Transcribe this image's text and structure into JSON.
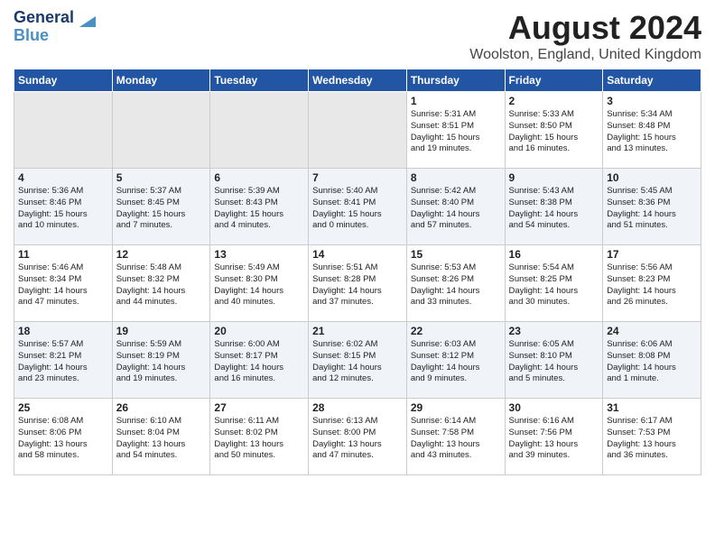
{
  "header": {
    "logo_line1": "General",
    "logo_line2": "Blue",
    "month_year": "August 2024",
    "location": "Woolston, England, United Kingdom"
  },
  "days_of_week": [
    "Sunday",
    "Monday",
    "Tuesday",
    "Wednesday",
    "Thursday",
    "Friday",
    "Saturday"
  ],
  "weeks": [
    [
      {
        "day": "",
        "info": ""
      },
      {
        "day": "",
        "info": ""
      },
      {
        "day": "",
        "info": ""
      },
      {
        "day": "",
        "info": ""
      },
      {
        "day": "1",
        "info": "Sunrise: 5:31 AM\nSunset: 8:51 PM\nDaylight: 15 hours\nand 19 minutes."
      },
      {
        "day": "2",
        "info": "Sunrise: 5:33 AM\nSunset: 8:50 PM\nDaylight: 15 hours\nand 16 minutes."
      },
      {
        "day": "3",
        "info": "Sunrise: 5:34 AM\nSunset: 8:48 PM\nDaylight: 15 hours\nand 13 minutes."
      }
    ],
    [
      {
        "day": "4",
        "info": "Sunrise: 5:36 AM\nSunset: 8:46 PM\nDaylight: 15 hours\nand 10 minutes."
      },
      {
        "day": "5",
        "info": "Sunrise: 5:37 AM\nSunset: 8:45 PM\nDaylight: 15 hours\nand 7 minutes."
      },
      {
        "day": "6",
        "info": "Sunrise: 5:39 AM\nSunset: 8:43 PM\nDaylight: 15 hours\nand 4 minutes."
      },
      {
        "day": "7",
        "info": "Sunrise: 5:40 AM\nSunset: 8:41 PM\nDaylight: 15 hours\nand 0 minutes."
      },
      {
        "day": "8",
        "info": "Sunrise: 5:42 AM\nSunset: 8:40 PM\nDaylight: 14 hours\nand 57 minutes."
      },
      {
        "day": "9",
        "info": "Sunrise: 5:43 AM\nSunset: 8:38 PM\nDaylight: 14 hours\nand 54 minutes."
      },
      {
        "day": "10",
        "info": "Sunrise: 5:45 AM\nSunset: 8:36 PM\nDaylight: 14 hours\nand 51 minutes."
      }
    ],
    [
      {
        "day": "11",
        "info": "Sunrise: 5:46 AM\nSunset: 8:34 PM\nDaylight: 14 hours\nand 47 minutes."
      },
      {
        "day": "12",
        "info": "Sunrise: 5:48 AM\nSunset: 8:32 PM\nDaylight: 14 hours\nand 44 minutes."
      },
      {
        "day": "13",
        "info": "Sunrise: 5:49 AM\nSunset: 8:30 PM\nDaylight: 14 hours\nand 40 minutes."
      },
      {
        "day": "14",
        "info": "Sunrise: 5:51 AM\nSunset: 8:28 PM\nDaylight: 14 hours\nand 37 minutes."
      },
      {
        "day": "15",
        "info": "Sunrise: 5:53 AM\nSunset: 8:26 PM\nDaylight: 14 hours\nand 33 minutes."
      },
      {
        "day": "16",
        "info": "Sunrise: 5:54 AM\nSunset: 8:25 PM\nDaylight: 14 hours\nand 30 minutes."
      },
      {
        "day": "17",
        "info": "Sunrise: 5:56 AM\nSunset: 8:23 PM\nDaylight: 14 hours\nand 26 minutes."
      }
    ],
    [
      {
        "day": "18",
        "info": "Sunrise: 5:57 AM\nSunset: 8:21 PM\nDaylight: 14 hours\nand 23 minutes."
      },
      {
        "day": "19",
        "info": "Sunrise: 5:59 AM\nSunset: 8:19 PM\nDaylight: 14 hours\nand 19 minutes."
      },
      {
        "day": "20",
        "info": "Sunrise: 6:00 AM\nSunset: 8:17 PM\nDaylight: 14 hours\nand 16 minutes."
      },
      {
        "day": "21",
        "info": "Sunrise: 6:02 AM\nSunset: 8:15 PM\nDaylight: 14 hours\nand 12 minutes."
      },
      {
        "day": "22",
        "info": "Sunrise: 6:03 AM\nSunset: 8:12 PM\nDaylight: 14 hours\nand 9 minutes."
      },
      {
        "day": "23",
        "info": "Sunrise: 6:05 AM\nSunset: 8:10 PM\nDaylight: 14 hours\nand 5 minutes."
      },
      {
        "day": "24",
        "info": "Sunrise: 6:06 AM\nSunset: 8:08 PM\nDaylight: 14 hours\nand 1 minute."
      }
    ],
    [
      {
        "day": "25",
        "info": "Sunrise: 6:08 AM\nSunset: 8:06 PM\nDaylight: 13 hours\nand 58 minutes."
      },
      {
        "day": "26",
        "info": "Sunrise: 6:10 AM\nSunset: 8:04 PM\nDaylight: 13 hours\nand 54 minutes."
      },
      {
        "day": "27",
        "info": "Sunrise: 6:11 AM\nSunset: 8:02 PM\nDaylight: 13 hours\nand 50 minutes."
      },
      {
        "day": "28",
        "info": "Sunrise: 6:13 AM\nSunset: 8:00 PM\nDaylight: 13 hours\nand 47 minutes."
      },
      {
        "day": "29",
        "info": "Sunrise: 6:14 AM\nSunset: 7:58 PM\nDaylight: 13 hours\nand 43 minutes."
      },
      {
        "day": "30",
        "info": "Sunrise: 6:16 AM\nSunset: 7:56 PM\nDaylight: 13 hours\nand 39 minutes."
      },
      {
        "day": "31",
        "info": "Sunrise: 6:17 AM\nSunset: 7:53 PM\nDaylight: 13 hours\nand 36 minutes."
      }
    ]
  ]
}
